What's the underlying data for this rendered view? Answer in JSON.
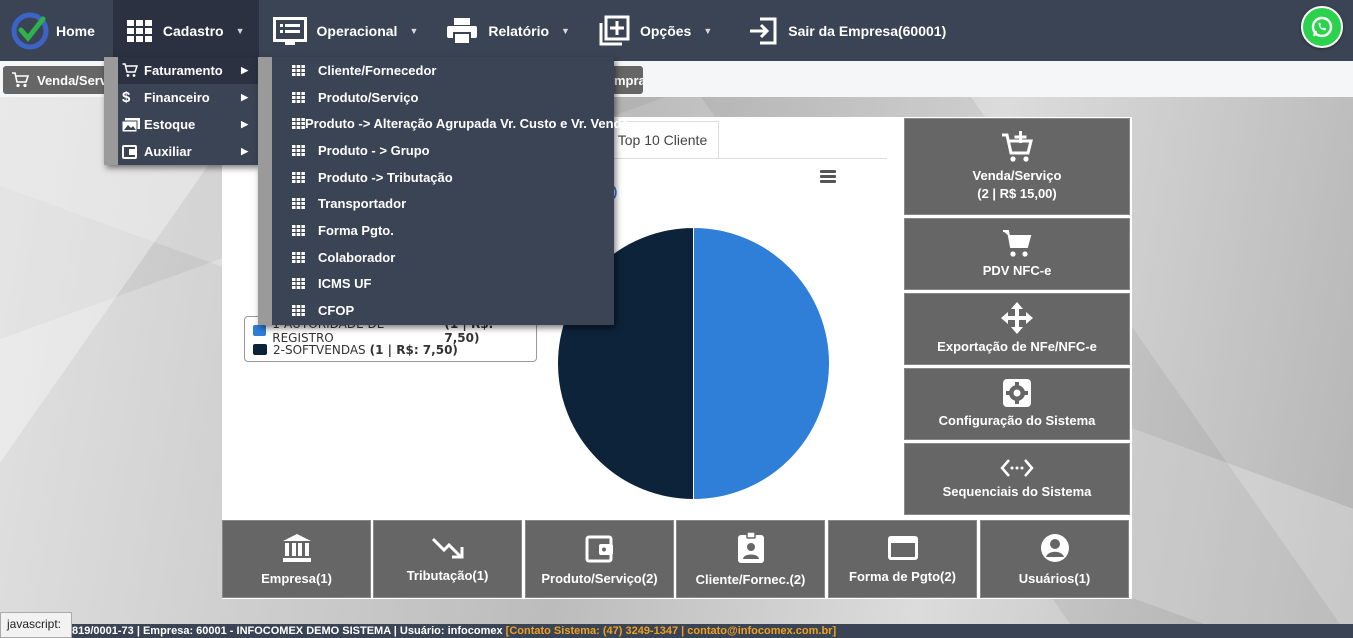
{
  "nav": {
    "home": "Home",
    "cadastro": "Cadastro",
    "operacional": "Operacional",
    "relatorio": "Relatório",
    "opcoes": "Opções",
    "sair": "Sair da Empresa(60001)"
  },
  "quick": {
    "venda_label": "Venda/Serv",
    "compra_tail": "mpra"
  },
  "menu_cadastro": [
    {
      "label": "Faturamento",
      "icon": "cart-icon"
    },
    {
      "label": "Financeiro",
      "icon": "dollar-icon"
    },
    {
      "label": "Estoque",
      "icon": "photos-icon"
    },
    {
      "label": "Auxiliar",
      "icon": "wallet-icon"
    }
  ],
  "menu_faturamento": [
    "Cliente/Fornecedor",
    "Produto/Serviço",
    "Produto -> Alteração Agrupada Vr. Custo e Vr. Venda",
    "Produto - > Grupo",
    "Produto -> Tributação",
    "Transportador",
    "Forma Pgto.",
    "Colaborador",
    "ICMS UF",
    "CFOP"
  ],
  "chart": {
    "tab_label": "Top 10 Cliente",
    "stray_text": ")"
  },
  "chart_data": {
    "type": "pie",
    "series": [
      {
        "label": "1-AUTORIDADE DE REGISTRO",
        "value_text": "(1 | R$: 7,50)",
        "value": 7.5,
        "color": "#2f7ed8"
      },
      {
        "label": "2-SOFTVENDAS",
        "value_text": "(1 | R$: 7,50)",
        "value": 7.5,
        "color": "#0d233a"
      }
    ]
  },
  "right_tiles": [
    {
      "line1": "Venda/Serviço",
      "line2": "(2 | R$ 15,00)"
    },
    {
      "line1": "PDV NFC-e",
      "line2": ""
    },
    {
      "line1": "Exportação de NFe/NFC-e",
      "line2": ""
    },
    {
      "line1": "Configuração do Sistema",
      "line2": ""
    },
    {
      "line1": "Sequenciais do Sistema",
      "line2": ""
    }
  ],
  "bottom_tiles": [
    "Empresa(1)",
    "Tributação(1)",
    "Produto/Serviço(2)",
    "Cliente/Fornec.(2)",
    "Forma de Pgto(2)",
    "Usuários(1)"
  ],
  "footer": {
    "main": "819/0001-73 | Empresa: 60001 - INFOCOMEX DEMO SISTEMA | Usuário: infocomex ",
    "contact": "[Contato Sistema: (47) 3249-1347 | contato@infocomex.com.br]",
    "status": "javascript:"
  },
  "colors": {
    "nav_bg": "#3b4454",
    "tile_bg": "#666666",
    "whatsapp": "#2bd24c",
    "footer_contact": "#f0a020"
  }
}
